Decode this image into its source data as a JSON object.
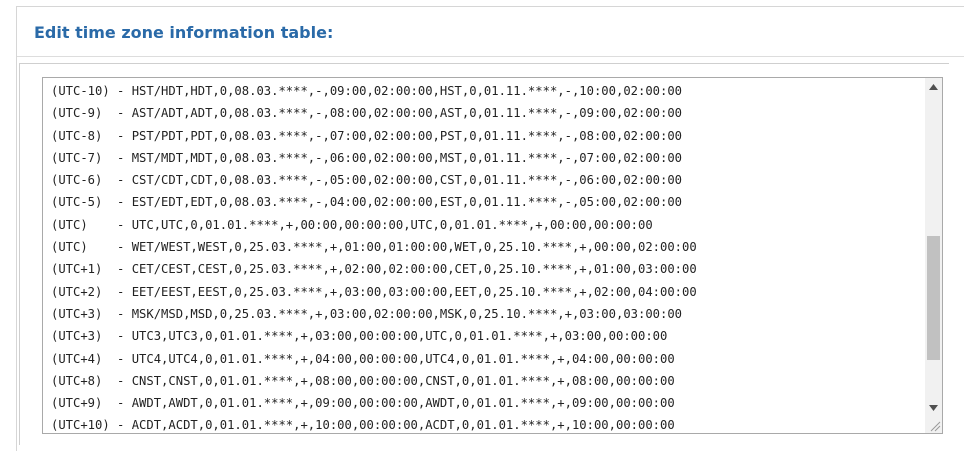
{
  "panel": {
    "title": "Edit time zone information table:"
  },
  "timezone_table": {
    "lines": [
      "(UTC-10) - HST/HDT,HDT,0,08.03.****,-,09:00,02:00:00,HST,0,01.11.****,-,10:00,02:00:00",
      "(UTC-9)  - AST/ADT,ADT,0,08.03.****,-,08:00,02:00:00,AST,0,01.11.****,-,09:00,02:00:00",
      "(UTC-8)  - PST/PDT,PDT,0,08.03.****,-,07:00,02:00:00,PST,0,01.11.****,-,08:00,02:00:00",
      "(UTC-7)  - MST/MDT,MDT,0,08.03.****,-,06:00,02:00:00,MST,0,01.11.****,-,07:00,02:00:00",
      "(UTC-6)  - CST/CDT,CDT,0,08.03.****,-,05:00,02:00:00,CST,0,01.11.****,-,06:00,02:00:00",
      "(UTC-5)  - EST/EDT,EDT,0,08.03.****,-,04:00,02:00:00,EST,0,01.11.****,-,05:00,02:00:00",
      "(UTC)    - UTC,UTC,0,01.01.****,+,00:00,00:00:00,UTC,0,01.01.****,+,00:00,00:00:00",
      "(UTC)    - WET/WEST,WEST,0,25.03.****,+,01:00,01:00:00,WET,0,25.10.****,+,00:00,02:00:00",
      "(UTC+1)  - CET/CEST,CEST,0,25.03.****,+,02:00,02:00:00,CET,0,25.10.****,+,01:00,03:00:00",
      "(UTC+2)  - EET/EEST,EEST,0,25.03.****,+,03:00,03:00:00,EET,0,25.10.****,+,02:00,04:00:00",
      "(UTC+3)  - MSK/MSD,MSD,0,25.03.****,+,03:00,02:00:00,MSK,0,25.10.****,+,03:00,03:00:00",
      "(UTC+3)  - UTC3,UTC3,0,01.01.****,+,03:00,00:00:00,UTC,0,01.01.****,+,03:00,00:00:00",
      "(UTC+4)  - UTC4,UTC4,0,01.01.****,+,04:00,00:00:00,UTC4,0,01.01.****,+,04:00,00:00:00",
      "(UTC+8)  - CNST,CNST,0,01.01.****,+,08:00,00:00:00,CNST,0,01.01.****,+,08:00,00:00:00",
      "(UTC+9)  - AWDT,AWDT,0,01.01.****,+,09:00,00:00:00,AWDT,0,01.01.****,+,09:00,00:00:00",
      "(UTC+10) - ACDT,ACDT,0,01.01.****,+,10:00,00:00:00,ACDT,0,01.01.****,+,10:00,00:00:00"
    ],
    "scrollbar": {
      "position": 0.55
    }
  },
  "icons": {
    "scroll_up": "triangle-up-icon",
    "scroll_down": "triangle-down-icon",
    "resize": "resize-grip-icon"
  },
  "colors": {
    "title": "#2a6aa8",
    "text": "#222222",
    "scrollbar_track": "#f1f1f1",
    "scrollbar_thumb": "#c1c1c1"
  }
}
